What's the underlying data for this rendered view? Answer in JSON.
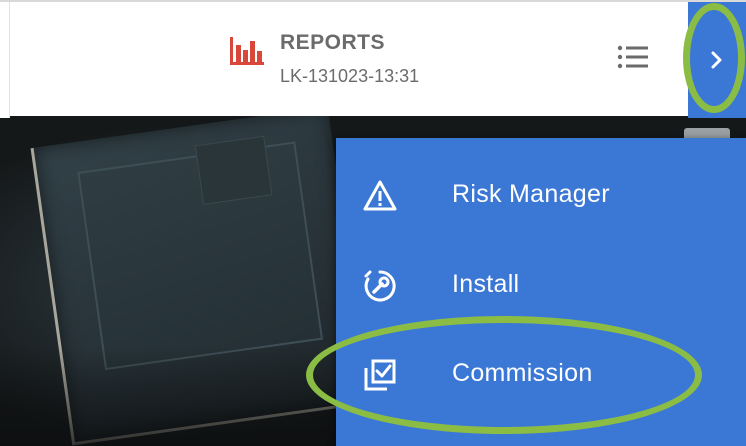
{
  "header": {
    "title": "REPORTS",
    "subtitle": "LK-131023-13:31",
    "report_icon": "bar-chart-icon",
    "list_icon": "list-icon",
    "expand_icon": "chevron-right-icon"
  },
  "menu": {
    "items": [
      {
        "label": "Risk Manager",
        "icon": "warning-triangle-icon"
      },
      {
        "label": "Install",
        "icon": "wrench-circle-icon"
      },
      {
        "label": "Commission",
        "icon": "checkbox-stack-icon"
      }
    ]
  },
  "colors": {
    "accent_blue": "#3b78d6",
    "report_icon_red": "#d9473b",
    "header_text": "#6b6b6b",
    "annotation_green": "#8bbd45"
  }
}
